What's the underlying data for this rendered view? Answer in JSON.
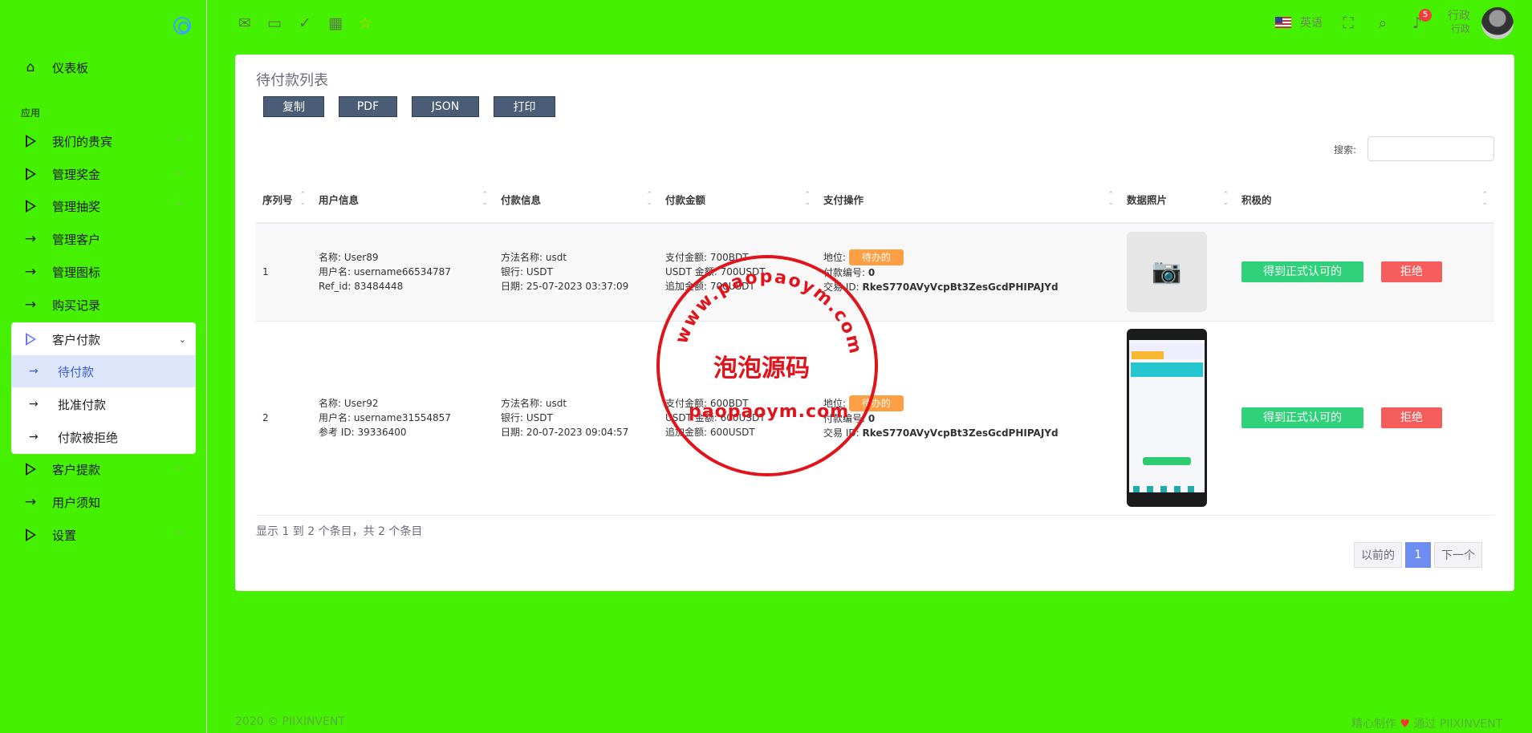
{
  "sidebar": {
    "menu_home": "仪表板",
    "section": "应用",
    "items": [
      {
        "label": "我们的贵宾",
        "icon": "play-icon",
        "chevron": "^"
      },
      {
        "label": "管理奖金",
        "icon": "play-icon",
        "chevron": "^"
      },
      {
        "label": "管理抽奖",
        "icon": "play-icon",
        "chevron": "^"
      },
      {
        "label": "管理客户",
        "icon": "arrow-right-icon"
      },
      {
        "label": "管理图标",
        "icon": "arrow-right-icon"
      },
      {
        "label": "购买记录",
        "icon": "arrow-right-icon"
      }
    ],
    "open_group": {
      "label": "客户付款",
      "children": [
        "待付款",
        "批准付款",
        "付款被拒绝"
      ]
    },
    "items_after": [
      {
        "label": "客户提款",
        "icon": "play-icon",
        "chevron": "^"
      },
      {
        "label": "用户须知",
        "icon": "arrow-right-icon"
      },
      {
        "label": "设置",
        "icon": "play-icon",
        "chevron": "^"
      }
    ]
  },
  "topbar": {
    "language": "英语",
    "notification_count": "5",
    "user_name": "行政",
    "user_role": "行政"
  },
  "card": {
    "title": "待付款列表",
    "buttons": [
      "复制",
      "PDF",
      "JSON",
      "打印"
    ],
    "search_label": "搜索:",
    "columns": [
      "序列号",
      "用户信息",
      "付款信息",
      "付款金额",
      "支付操作",
      "数据照片",
      "积极的"
    ],
    "rows": [
      {
        "serial": "1",
        "user": [
          "名称: User89",
          "用户名: username66534787",
          "Ref_id: 83484448"
        ],
        "payment": [
          "方法名称: usdt",
          "银行: USDT",
          "日期: 25-07-2023 03:37:09"
        ],
        "amount": [
          "支付金额: 700BDT",
          "USDT 金额: 700USDT",
          "追加金额: 700USDT"
        ],
        "status_label": "地位:",
        "status": "待办的",
        "pay_no_label": "付款编号:",
        "pay_no": "0",
        "tx_label": "交易 ID:",
        "tx_id": "RkeS770AVyVcpBt3ZesGcdPHIPAJYd",
        "approve": "得到正式认可的",
        "reject": "拒绝"
      },
      {
        "serial": "2",
        "user": [
          "名称: User92",
          "用户名: username31554857",
          "参考 ID: 39336400"
        ],
        "payment": [
          "方法名称: usdt",
          "银行: USDT",
          "日期: 20-07-2023 09:04:57"
        ],
        "amount": [
          "支付金额: 600BDT",
          "USDT 金额: 600USDT",
          "追加金额: 600USDT"
        ],
        "status_label": "地位:",
        "status": "待办的",
        "pay_no_label": "付款编号:",
        "pay_no": "0",
        "tx_label": "交易 ID:",
        "tx_id": "RkeS770AVyVcpBt3ZesGcdPHIPAJYd",
        "approve": "得到正式认可的",
        "reject": "拒绝"
      }
    ],
    "info": "显示 1 到 2 个条目，共 2 个条目",
    "pager": {
      "prev": "以前的",
      "current": "1",
      "next": "下一个"
    }
  },
  "watermark": {
    "main": "泡泡源码",
    "url": "paopaoym.com",
    "ring": "www.paopaoym.com"
  },
  "footer": {
    "left": "2020 © PIIXINVENT",
    "right_prefix": "精心制作",
    "right_suffix": "通过 PIIXINVENT"
  }
}
